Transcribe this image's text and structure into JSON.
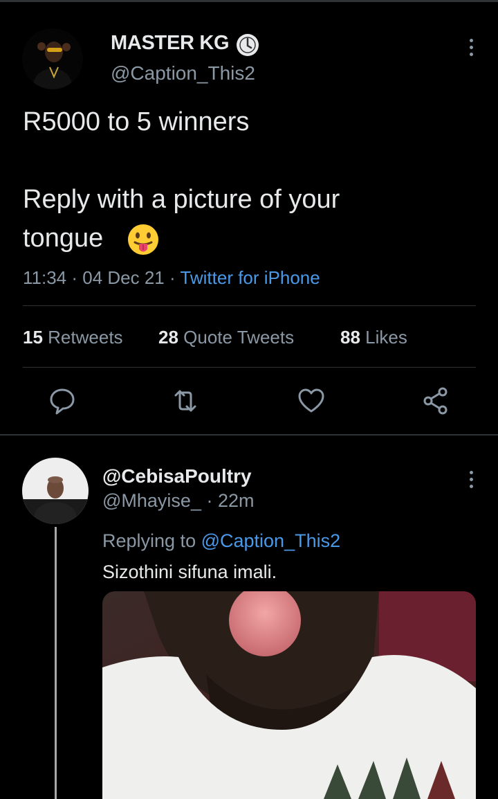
{
  "tweet": {
    "author_name": "MASTER KG",
    "author_handle": "@Caption_This2",
    "line1": "R5000 to 5 winners",
    "line2": "Reply with a picture of your",
    "line3": "tongue",
    "emoji": "tongue-out-face-emoji",
    "time": "11:34 · 04 Dec 21 · ",
    "source": "Twitter for iPhone",
    "retweets_count": "15",
    "retweets_label": "Retweets",
    "quotes_count": "28",
    "quotes_label": "Quote Tweets",
    "likes_count": "88",
    "likes_label": "Likes"
  },
  "reply": {
    "author_name": "@CebisaPoultry",
    "author_handle": "@Mhayise_",
    "time": " · 22m",
    "replying_prefix": "Replying to ",
    "replying_handle": "@Caption_This2",
    "text": "Sizothini sifuna imali."
  },
  "colors": {
    "background": "#000000",
    "text": "#e7e9ea",
    "muted": "#8b98a5",
    "link": "#4a99e9",
    "divider": "#2f3336"
  },
  "icons": [
    "more-icon",
    "verified-badge-icon",
    "reply-icon",
    "retweet-icon",
    "like-icon",
    "share-icon"
  ]
}
